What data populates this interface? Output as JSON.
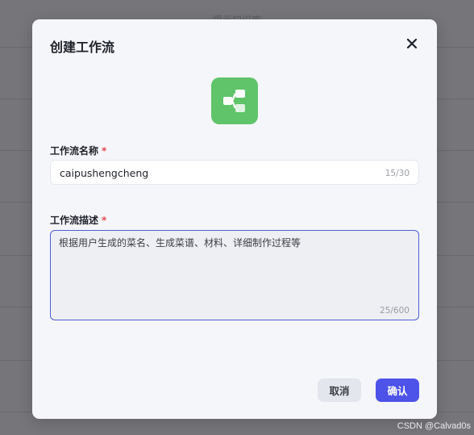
{
  "background": {
    "page_title": "提示知识库"
  },
  "modal": {
    "title": "创建工作流",
    "close_icon": "close-icon",
    "app_icon": "workflow-icon",
    "name_field": {
      "label": "工作流名称",
      "required_mark": "*",
      "value": "caipushengcheng",
      "counter": "15/30"
    },
    "description_field": {
      "label": "工作流描述",
      "required_mark": "*",
      "value": "根据用户生成的菜名、生成菜谱、材料、详细制作过程等",
      "counter": "25/600"
    },
    "buttons": {
      "cancel": "取消",
      "confirm": "确认"
    }
  },
  "watermark": "CSDN @Calvad0s",
  "colors": {
    "accent": "#4d53e8",
    "icon_bg": "#5fc46a",
    "required": "#e5484d"
  }
}
